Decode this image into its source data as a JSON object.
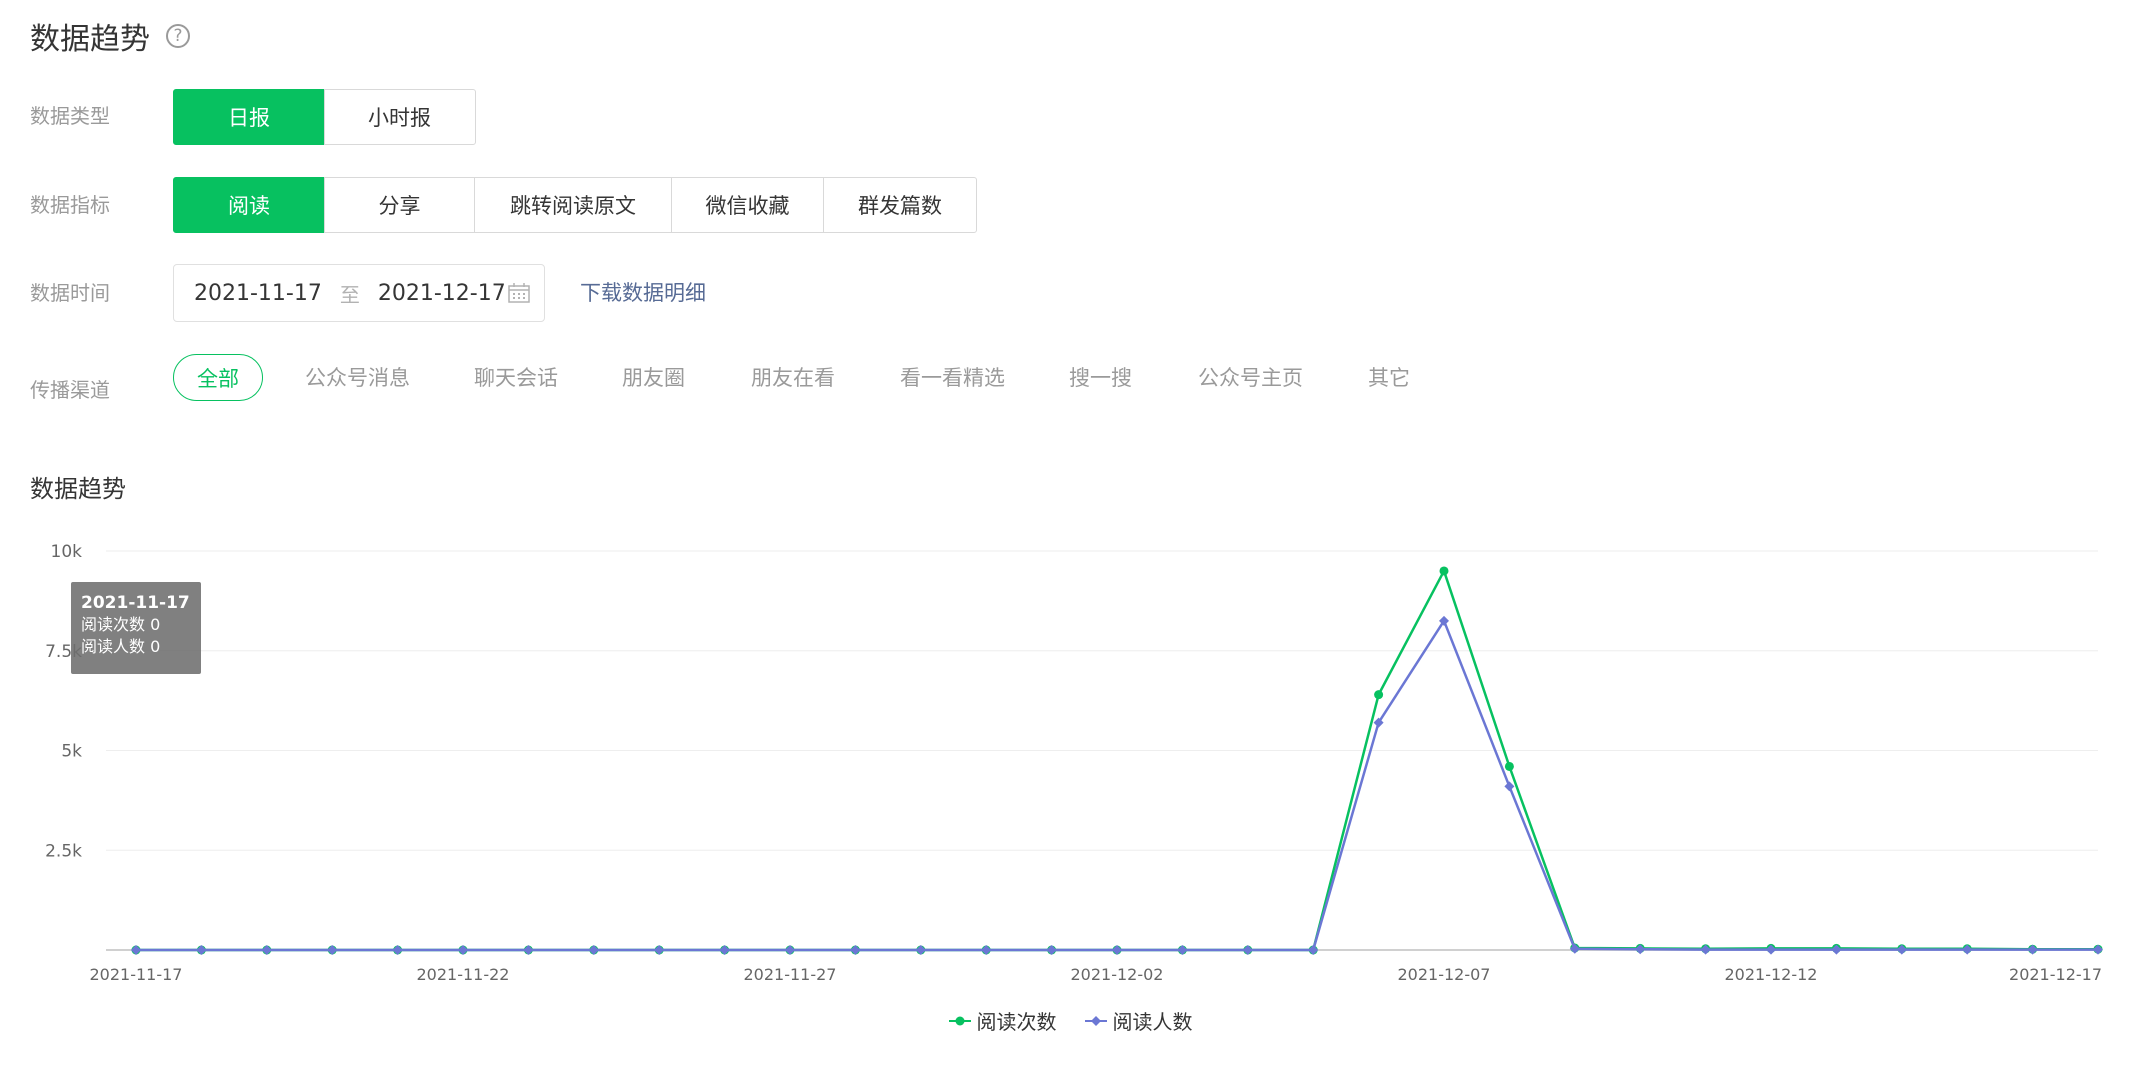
{
  "header": {
    "title": "数据趋势"
  },
  "filters": {
    "data_type": {
      "label": "数据类型",
      "options": [
        "日报",
        "小时报"
      ],
      "selected": "日报"
    },
    "metric": {
      "label": "数据指标",
      "options": [
        "阅读",
        "分享",
        "跳转阅读原文",
        "微信收藏",
        "群发篇数"
      ],
      "selected": "阅读"
    },
    "time": {
      "label": "数据时间",
      "start": "2021-11-17",
      "separator": "至",
      "end": "2021-12-17",
      "download_link": "下载数据明细"
    },
    "channel": {
      "label": "传播渠道",
      "options": [
        "全部",
        "公众号消息",
        "聊天会话",
        "朋友圈",
        "朋友在看",
        "看一看精选",
        "搜一搜",
        "公众号主页",
        "其它"
      ],
      "selected": "全部"
    }
  },
  "colors": {
    "accent": "#07c160",
    "series_1": "#07c160",
    "series_2": "#6b77d4",
    "link": "#576b95"
  },
  "section": {
    "title": "数据趋势"
  },
  "tooltip": {
    "date": "2021-11-17",
    "line1_label": "阅读次数",
    "line1_value": "0",
    "line2_label": "阅读人数",
    "line2_value": "0"
  },
  "chart_data": {
    "type": "line",
    "title": "数据趋势",
    "x": [
      "2021-11-17",
      "2021-11-18",
      "2021-11-19",
      "2021-11-20",
      "2021-11-21",
      "2021-11-22",
      "2021-11-23",
      "2021-11-24",
      "2021-11-25",
      "2021-11-26",
      "2021-11-27",
      "2021-11-28",
      "2021-11-29",
      "2021-11-30",
      "2021-12-01",
      "2021-12-02",
      "2021-12-03",
      "2021-12-04",
      "2021-12-05",
      "2021-12-06",
      "2021-12-07",
      "2021-12-08",
      "2021-12-09",
      "2021-12-10",
      "2021-12-11",
      "2021-12-12",
      "2021-12-13",
      "2021-12-14",
      "2021-12-15",
      "2021-12-16",
      "2021-12-17"
    ],
    "x_tick_labels": [
      "2021-11-17",
      "2021-11-22",
      "2021-11-27",
      "2021-12-02",
      "2021-12-07",
      "2021-12-12",
      "2021-12-17"
    ],
    "y_tick_labels": [
      "10k",
      "7.5k",
      "5k",
      "2.5k"
    ],
    "ylim": [
      0,
      10000
    ],
    "grid": true,
    "legend_position": "bottom",
    "series": [
      {
        "name": "阅读次数",
        "color": "#07c160",
        "values": [
          0,
          0,
          0,
          0,
          0,
          0,
          0,
          0,
          0,
          0,
          0,
          0,
          0,
          0,
          0,
          0,
          0,
          0,
          0,
          6400,
          9500,
          4600,
          50,
          40,
          30,
          40,
          40,
          30,
          30,
          20,
          20
        ]
      },
      {
        "name": "阅读人数",
        "color": "#6b77d4",
        "values": [
          0,
          0,
          0,
          0,
          0,
          0,
          0,
          0,
          0,
          0,
          0,
          0,
          0,
          0,
          0,
          0,
          0,
          0,
          0,
          5700,
          8250,
          4100,
          30,
          20,
          10,
          10,
          10,
          10,
          10,
          10,
          10
        ]
      }
    ]
  }
}
